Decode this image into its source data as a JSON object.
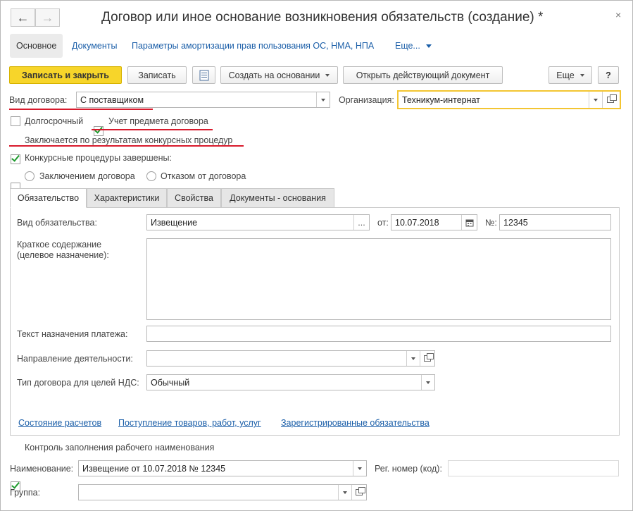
{
  "window": {
    "title": "Договор или иное основание возникновения обязательств (создание) *",
    "back_icon": "←",
    "forward_icon": "→",
    "close_icon": "×"
  },
  "nav_tabs": {
    "main": "Основное",
    "documents": "Документы",
    "amortization": "Параметры амортизации прав пользования ОС, НМА, НПА",
    "more": "Еще..."
  },
  "toolbar": {
    "save_close": "Записать и закрыть",
    "save": "Записать",
    "create_based": "Создать на основании",
    "open_document": "Открыть действующий документ",
    "more": "Еще",
    "help": "?"
  },
  "form": {
    "contract_type_label": "Вид договора:",
    "contract_type_value": "С поставщиком",
    "organization_label": "Организация:",
    "organization_value": "Техникум-интернат",
    "long_term_label": "Долгосрочный",
    "subject_accounting_label": "Учет предмета договора",
    "competitive_label": "Заключается по результатам конкурсных процедур",
    "procedures_completed_label": "Конкурсные процедуры завершены:",
    "radio_conclusion": "Заключением договора",
    "radio_refusal": "Отказом от договора"
  },
  "tabs": [
    "Обязательство",
    "Характеристики",
    "Свойства",
    "Документы - основания"
  ],
  "obligation": {
    "type_label": "Вид обязательства:",
    "type_value": "Извещение",
    "from_label": "от:",
    "date_value": "10.07.2018",
    "number_label": "№:",
    "number_value": "12345",
    "summary_label_1": "Краткое содержание",
    "summary_label_2": "(целевое назначение):",
    "payment_text_label": "Текст назначения платежа:",
    "activity_label": "Направление деятельности:",
    "vat_type_label": "Тип договора для целей НДС:",
    "vat_type_value": "Обычный",
    "ellipsis": "..."
  },
  "links": {
    "settlements": "Состояние расчетов",
    "receipts": "Поступление товаров, работ, услуг",
    "registered": "Зарегистрированные обязательства"
  },
  "bottom": {
    "control_label": "Контроль заполнения рабочего наименования",
    "name_label": "Наименование:",
    "name_value": "Извещение от 10.07.2018 № 12345",
    "reg_label": "Рег. номер (код):",
    "group_label": "Группа:"
  },
  "checkbox_states": {
    "long_term": false,
    "subject_accounting": true,
    "competitive": true,
    "procedures_completed": false,
    "control": true
  },
  "colors": {
    "primary_button": "#f7d52a",
    "link": "#1a5ea8",
    "annotation_underline": "#d81a2c",
    "checkmark": "#1e9b2e",
    "focus_border": "#f3c532"
  }
}
